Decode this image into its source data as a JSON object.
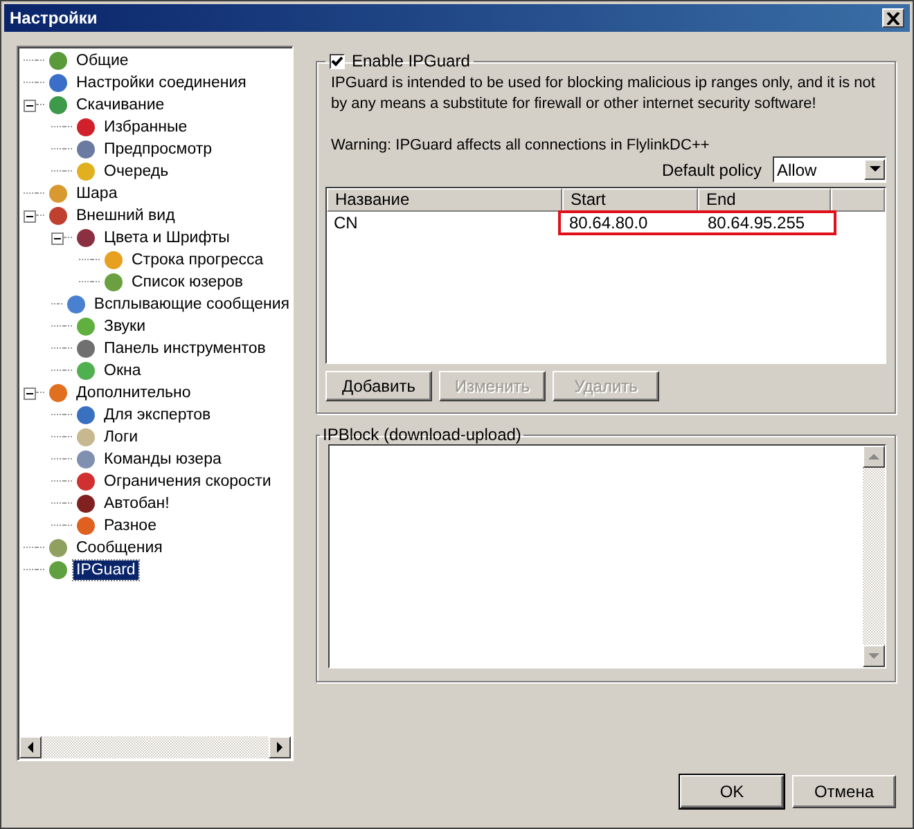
{
  "window": {
    "title": "Настройки"
  },
  "tree": [
    {
      "label": "Общие",
      "selected": false
    },
    {
      "label": "Настройки соединения",
      "selected": false
    },
    {
      "label": "Скачивание",
      "selected": false,
      "expanded": true,
      "children": [
        {
          "label": "Избранные",
          "selected": false
        },
        {
          "label": "Предпросмотр",
          "selected": false
        },
        {
          "label": "Очередь",
          "selected": false
        }
      ]
    },
    {
      "label": "Шара",
      "selected": false
    },
    {
      "label": "Внешний вид",
      "selected": false,
      "expanded": true,
      "children": [
        {
          "label": "Цвета и Шрифты",
          "selected": false,
          "expanded": true,
          "children": [
            {
              "label": "Строка прогресса",
              "selected": false
            },
            {
              "label": "Список юзеров",
              "selected": false
            }
          ]
        },
        {
          "label": "Всплывающие сообщения",
          "selected": false
        },
        {
          "label": "Звуки",
          "selected": false
        },
        {
          "label": "Панель инструментов",
          "selected": false
        },
        {
          "label": "Окна",
          "selected": false
        }
      ]
    },
    {
      "label": "Дополнительно",
      "selected": false,
      "expanded": true,
      "children": [
        {
          "label": "Для экспертов",
          "selected": false
        },
        {
          "label": "Логи",
          "selected": false
        },
        {
          "label": "Команды юзера",
          "selected": false
        },
        {
          "label": "Ограничения скорости",
          "selected": false
        },
        {
          "label": "Автобан!",
          "selected": false
        },
        {
          "label": "Разное",
          "selected": false
        }
      ]
    },
    {
      "label": "Сообщения",
      "selected": false
    },
    {
      "label": "IPGuard",
      "selected": true
    }
  ],
  "ipguard": {
    "enable_label": "Enable IPGuard",
    "checked": true,
    "description": "IPGuard is intended to be used for blocking malicious ip ranges only, and it is not by any means a substitute for firewall or other internet security software!",
    "warning": "Warning: IPGuard affects all connections in FlylinkDC++",
    "policy_label": "Default policy",
    "policy_value": "Allow",
    "columns": [
      "Название",
      "Start",
      "End"
    ],
    "rows": [
      {
        "cells": [
          "CN",
          "80.64.80.0",
          "80.64.95.255"
        ],
        "highlighted": true
      }
    ],
    "buttons": [
      {
        "label": "Добавить",
        "disabled": false
      },
      {
        "label": "Изменить",
        "disabled": true
      },
      {
        "label": "Удалить",
        "disabled": true
      }
    ]
  },
  "ipblock": {
    "title": "IPBlock (download-upload)"
  },
  "footer_buttons": [
    {
      "label": "OK",
      "default": true
    },
    {
      "label": "Отмена",
      "default": false
    }
  ]
}
